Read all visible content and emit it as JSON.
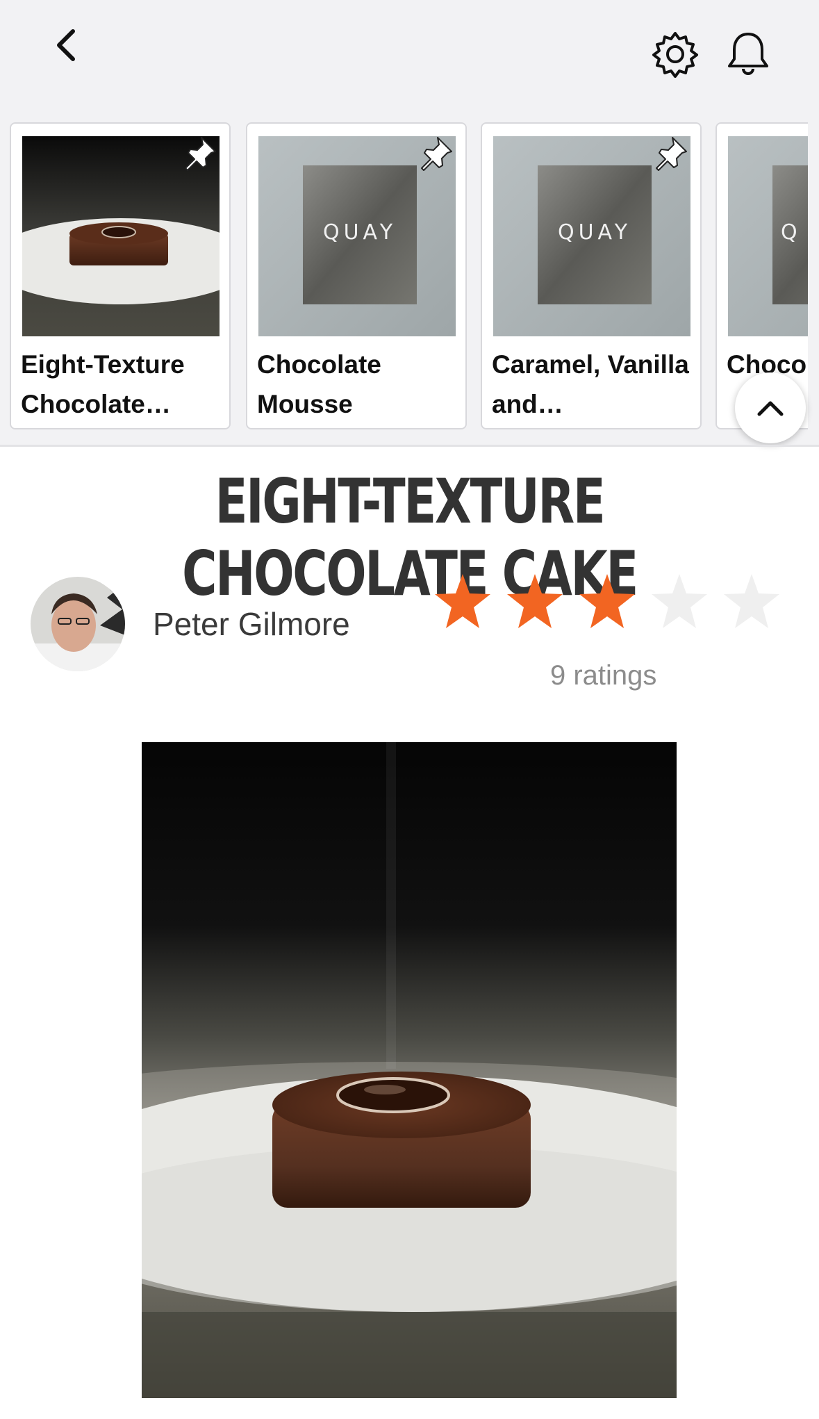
{
  "header": {
    "back_icon": "chevron-left-icon",
    "settings_icon": "gear-icon",
    "notifications_icon": "bell-icon"
  },
  "carousel": {
    "cards": [
      {
        "title": "Eight-Texture Chocolate…",
        "image": "chocolate-cake-photo",
        "pinned": true
      },
      {
        "title": "Chocolate Mousse",
        "image": "quay-book-cover",
        "cover_text": "QUAY",
        "pinned": true
      },
      {
        "title": "Caramel, Vanilla and…",
        "image": "quay-book-cover",
        "cover_text": "QUAY",
        "pinned": true
      },
      {
        "title": "Choco",
        "image": "quay-book-cover",
        "cover_text": "Q",
        "pinned": false
      }
    ],
    "scroll_up_icon": "chevron-up-icon"
  },
  "recipe": {
    "title": "EIGHT-TEXTURE CHOCOLATE CAKE",
    "author": "Peter Gilmore",
    "rating": {
      "stars": 3,
      "max": 5,
      "count_label": "9 ratings"
    },
    "accent_color": "#f26522"
  }
}
